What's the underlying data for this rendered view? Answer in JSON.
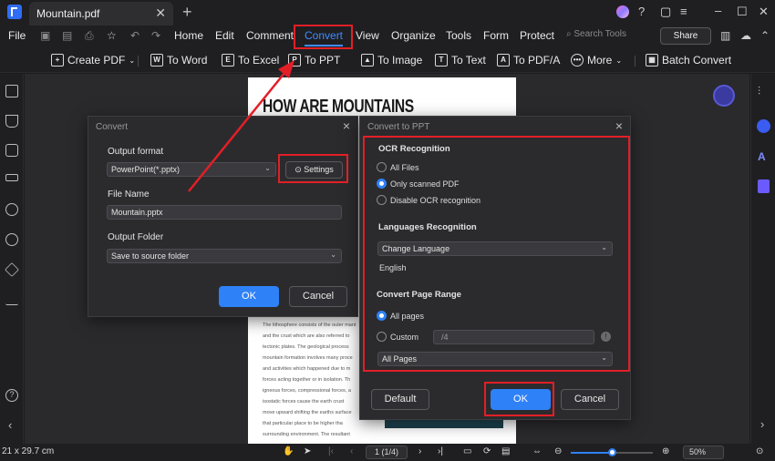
{
  "window": {
    "tab_title": "Mountain.pdf",
    "tab_close": "✕",
    "new_tab": "+",
    "controls": [
      "–",
      "☐",
      "✕"
    ]
  },
  "menu": {
    "file": "File",
    "items": [
      "Home",
      "Edit",
      "Comment",
      "Convert",
      "View",
      "Organize",
      "Tools",
      "Form",
      "Protect"
    ],
    "active": "Convert",
    "search_placeholder": "Search Tools",
    "share": "Share"
  },
  "toolbar": {
    "create_pdf": "Create PDF",
    "to_word": "To Word",
    "to_excel": "To Excel",
    "to_ppt": "To PPT",
    "to_image": "To Image",
    "to_text": "To Text",
    "to_pdfa": "To PDF/A",
    "more": "More",
    "batch_convert": "Batch Convert"
  },
  "document": {
    "title": "HOW ARE MOUNTAINS FORMED?",
    "body_lines": [
      "The lithosphere consists of the outer mant",
      "and the crust which are also referred to",
      "tectonic plates. The geological process",
      "mountain formation involves many proce",
      "and activities which happened due to m",
      "forces acting together or in isolation. Th",
      "igneous forces, compressional forces, a",
      "isostatic forces cause the earth crust",
      "move upward shifting the earths surface",
      "that particular place to be higher tha",
      "surrounding environment. The resultant"
    ]
  },
  "convert_dialog": {
    "title": "Convert",
    "output_format_label": "Output format",
    "output_format_value": "PowerPoint(*.pptx)",
    "settings_button": "Settings",
    "file_name_label": "File Name",
    "file_name_value": "Mountain.pptx",
    "output_folder_label": "Output Folder",
    "output_folder_value": "Save to source folder",
    "ok": "OK",
    "cancel": "Cancel"
  },
  "ppt_dialog": {
    "title": "Convert to PPT",
    "ocr_heading": "OCR Recognition",
    "ocr_options": [
      "All Files",
      "Only scanned PDF",
      "Disable OCR recognition"
    ],
    "ocr_selected": 1,
    "languages_heading": "Languages Recognition",
    "change_language": "Change Language",
    "language_value": "English",
    "range_heading": "Convert Page Range",
    "range_all": "All pages",
    "range_custom": "Custom",
    "custom_value": "/4",
    "page_subset": "All Pages",
    "default": "Default",
    "ok": "OK",
    "cancel": "Cancel"
  },
  "statusbar": {
    "page_size": "21 x 29.7 cm",
    "page_indicator": "1 (1/4)",
    "zoom": "50%",
    "zoom_fraction": 0.5
  },
  "colors": {
    "accent": "#2f81f7",
    "highlight": "#e21f26",
    "background": "#1c1c1f"
  }
}
